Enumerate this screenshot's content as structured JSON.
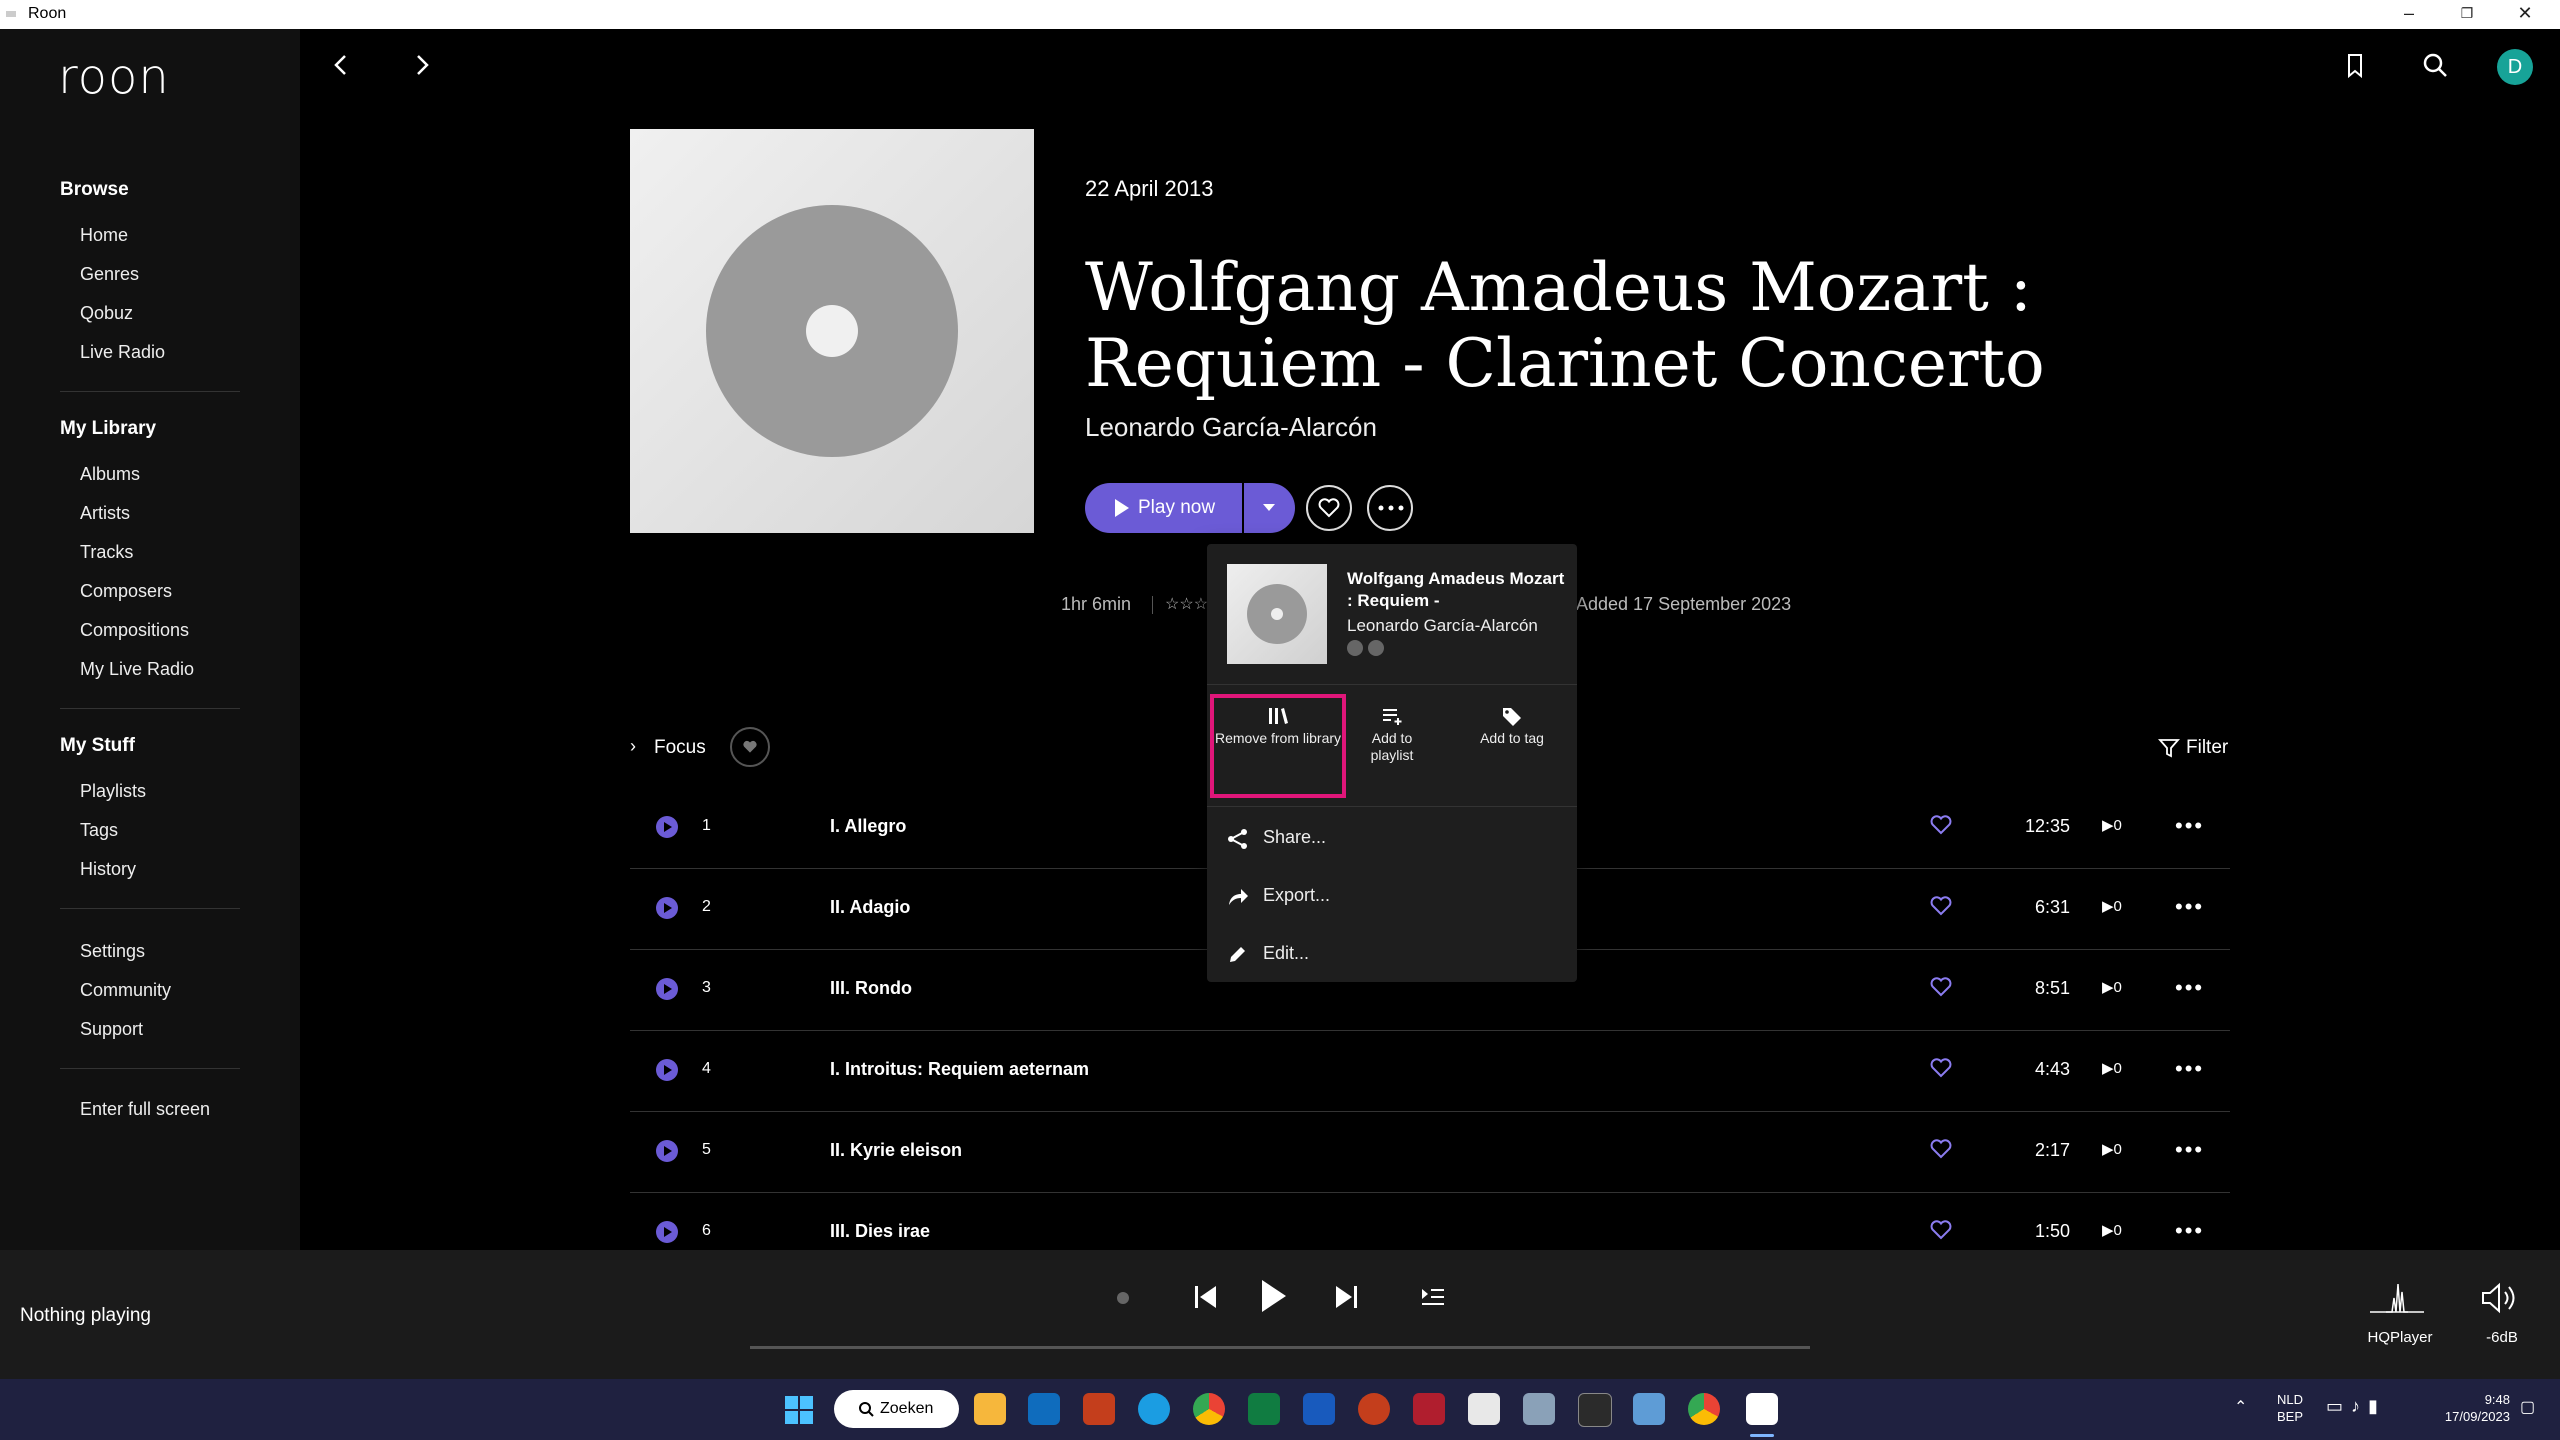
{
  "window": {
    "title": "Roon"
  },
  "sidebar": {
    "logo": "roon",
    "browse": {
      "heading": "Browse",
      "items": [
        "Home",
        "Genres",
        "Qobuz",
        "Live Radio"
      ]
    },
    "library": {
      "heading": "My Library",
      "items": [
        "Albums",
        "Artists",
        "Tracks",
        "Composers",
        "Compositions",
        "My Live Radio"
      ]
    },
    "stuff": {
      "heading": "My Stuff",
      "items": [
        "Playlists",
        "Tags",
        "History"
      ]
    },
    "misc": [
      "Settings",
      "Community",
      "Support"
    ],
    "fullscreen": "Enter full screen"
  },
  "header": {
    "avatar_letter": "D"
  },
  "album": {
    "date": "22 April 2013",
    "title": "Wolfgang Amadeus Mozart : Requiem - Clarinet Concerto",
    "artist": "Leonardo García-Alarcón",
    "play_label": "Play now",
    "duration": "1hr 6min",
    "added": "Added 17 September 2023"
  },
  "popup": {
    "title": "Wolfgang Amadeus Mozart : Requiem -",
    "artist": "Leonardo García-Alarcón",
    "actions": [
      "Remove from library",
      "Add to playlist",
      "Add to tag"
    ],
    "menu": [
      "Share...",
      "Export...",
      "Edit..."
    ]
  },
  "tracklist": {
    "focus_label": "Focus",
    "filter_label": "Filter",
    "tracks": [
      {
        "num": "1",
        "name": "I. Allegro",
        "duration": "12:35",
        "plays": "0"
      },
      {
        "num": "2",
        "name": "II. Adagio",
        "duration": "6:31",
        "plays": "0"
      },
      {
        "num": "3",
        "name": "III. Rondo",
        "duration": "8:51",
        "plays": "0"
      },
      {
        "num": "4",
        "name": "I. Introitus: Requiem aeternam",
        "duration": "4:43",
        "plays": "0"
      },
      {
        "num": "5",
        "name": "II. Kyrie eleison",
        "duration": "2:17",
        "plays": "0"
      },
      {
        "num": "6",
        "name": "III. Dies irae",
        "duration": "1:50",
        "plays": "0"
      }
    ]
  },
  "player": {
    "status": "Nothing playing",
    "zone": "HQPlayer",
    "volume": "-6dB"
  },
  "taskbar": {
    "search": "Zoeken",
    "lang1": "NLD",
    "lang2": "BEP",
    "time": "9:48",
    "date": "17/09/2023"
  },
  "colors": {
    "accent": "#6b5bd6",
    "highlight": "#e0167a",
    "heart": "#8b7cf0"
  }
}
